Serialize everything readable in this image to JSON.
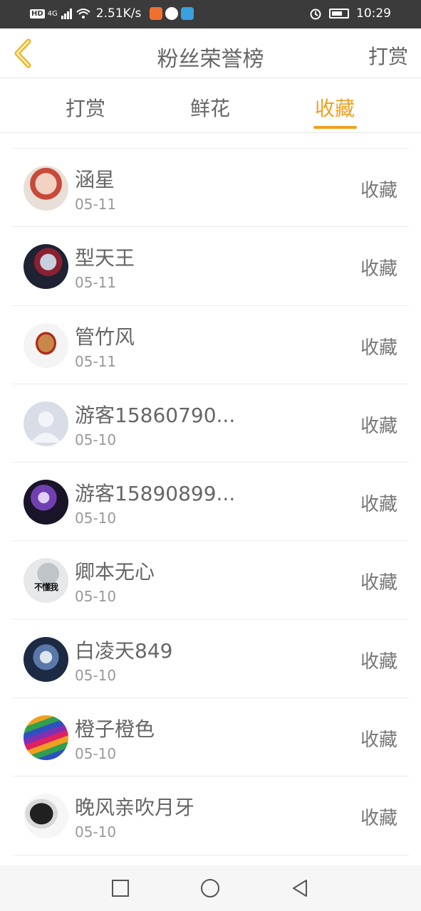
{
  "status_bar": {
    "hd": "HD",
    "network": "4G",
    "speed": "2.51K/s",
    "time": "10:29",
    "icons": [
      "signal-icon",
      "wifi-icon",
      "video-app-icon",
      "wechat-icon",
      "browser-app-icon",
      "alarm-icon",
      "battery-icon"
    ]
  },
  "header": {
    "back_icon": "chevron-left-icon",
    "title": "粉丝荣誉榜",
    "right_action": "打赏"
  },
  "tabs": [
    {
      "label": "打赏",
      "active": false
    },
    {
      "label": "鲜花",
      "active": false
    },
    {
      "label": "收藏",
      "active": true
    }
  ],
  "colors": {
    "accent": "#f0a020",
    "text": "#666666",
    "muted": "#999999",
    "status_bar": "#3b3b3b"
  },
  "fans": [
    {
      "name": "涵星",
      "date": "05-11",
      "action": "收藏"
    },
    {
      "name": "型天王",
      "date": "05-11",
      "action": "收藏"
    },
    {
      "name": "管竹风",
      "date": "05-11",
      "action": "收藏"
    },
    {
      "name": "游客15860790...",
      "date": "05-10",
      "action": "收藏"
    },
    {
      "name": "游客15890899...",
      "date": "05-10",
      "action": "收藏"
    },
    {
      "name": "卿本无心",
      "date": "05-10",
      "action": "收藏",
      "avatar_text": "不懂我"
    },
    {
      "name": "白凌天849",
      "date": "05-10",
      "action": "收藏"
    },
    {
      "name": "橙子橙色",
      "date": "05-10",
      "action": "收藏"
    },
    {
      "name": "晚风亲吹月牙",
      "date": "05-10",
      "action": "收藏"
    }
  ],
  "system_nav": {
    "icons": [
      "square-recents-icon",
      "circle-home-icon",
      "triangle-back-icon"
    ]
  }
}
